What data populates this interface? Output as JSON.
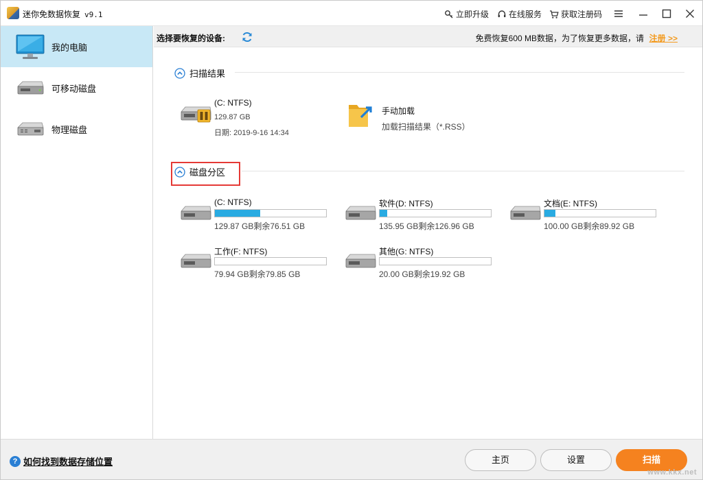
{
  "titlebar": {
    "app_name": "迷你免数据恢复",
    "version": "v9.1",
    "upgrade": "立即升级",
    "service": "在线服务",
    "get_code": "获取注册码"
  },
  "sidebar": {
    "items": [
      {
        "label": "我的电脑",
        "icon": "monitor-icon",
        "active": true
      },
      {
        "label": "可移动磁盘",
        "icon": "removable-disk-icon",
        "active": false
      },
      {
        "label": "物理磁盘",
        "icon": "physical-disk-icon",
        "active": false
      }
    ]
  },
  "header": {
    "choose_device": "选择要恢复的设备:",
    "promo": "免费恢复600 MB数据，为了恢复更多数据，请",
    "register_link": "注册 >>"
  },
  "scan_results": {
    "title": "扫描结果",
    "entries": [
      {
        "name": "(C: NTFS)",
        "size": "129.87 GB",
        "date": "日期: 2019-9-16 14:34"
      },
      {
        "name": "手动加载",
        "desc": "加载扫描结果（*.RSS）"
      }
    ]
  },
  "partitions": {
    "title": "磁盘分区",
    "items": [
      {
        "name": "(C: NTFS)",
        "used_fraction": 0.41,
        "capacity": "129.87 GB剩余76.51 GB"
      },
      {
        "name": "软件(D: NTFS)",
        "used_fraction": 0.07,
        "capacity": "135.95 GB剩余126.96 GB"
      },
      {
        "name": "文档(E: NTFS)",
        "used_fraction": 0.1,
        "capacity": "100.00 GB剩余89.92 GB"
      },
      {
        "name": "工作(F: NTFS)",
        "used_fraction": 0.0,
        "capacity": "79.94 GB剩余79.85 GB"
      },
      {
        "name": "其他(G: NTFS)",
        "used_fraction": 0.0,
        "capacity": "20.00 GB剩余19.92 GB"
      }
    ]
  },
  "footer": {
    "help": "如何找到数据存储位置",
    "home": "主页",
    "settings": "设置",
    "scan": "扫描",
    "watermark": "www.kkx.net"
  },
  "colors": {
    "accent": "#29abe2",
    "active_sidebar": "#c8e8f6",
    "primary_button": "#f5821f",
    "register_link": "#f39a1e",
    "highlight_box": "#e53935"
  }
}
